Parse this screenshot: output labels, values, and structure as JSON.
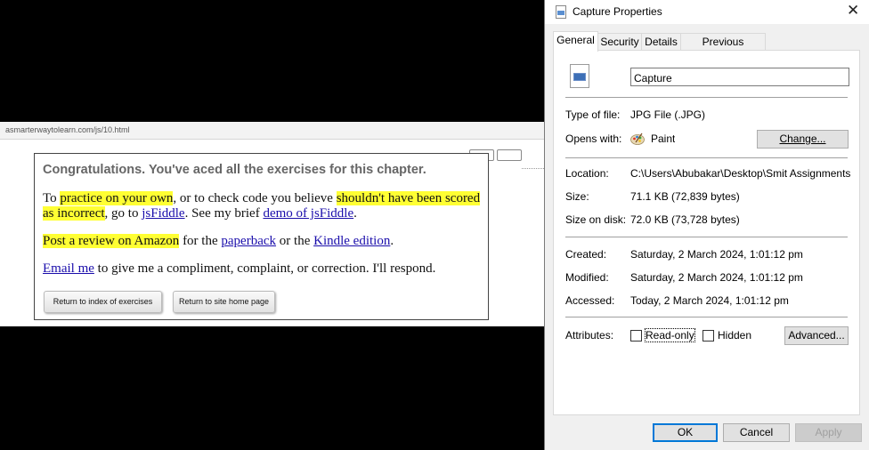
{
  "browser": {
    "url": "asmarterwaytolearn.com/js/10.html"
  },
  "card": {
    "heading": "Congratulations. You've aced all the exercises for this chapter.",
    "p1": {
      "t1": "To ",
      "h1": "practice on your own",
      "t2": ", or to check code you believe ",
      "h2": "shouldn't have been scored as incorrect",
      "t3": ", go to ",
      "l1": "jsFiddle",
      "t4": ". See my brief ",
      "l2": "demo of jsFiddle",
      "t5": "."
    },
    "p2": {
      "h1": "Post a review on Amazon",
      "t1": " for the ",
      "l1": "paperback",
      "t2": " or the ",
      "l2": "Kindle edition",
      "t3": "."
    },
    "p3": {
      "l1": "Email me",
      "t1": " to give me a compliment, complaint, or correction. I'll respond."
    },
    "buttons": {
      "index": "Return to index of exercises",
      "home": "Return to site home page"
    }
  },
  "dialog": {
    "title": "Capture Properties",
    "close": "✕",
    "tabs": [
      "General",
      "Security",
      "Details",
      "Previous Versions"
    ],
    "file_name": "Capture",
    "rows": {
      "type_label": "Type of file:",
      "type_value": "JPG File (.JPG)",
      "opens_label": "Opens with:",
      "opens_value": "Paint",
      "change_button": "Change...",
      "location_label": "Location:",
      "location_value": "C:\\Users\\Abubakar\\Desktop\\Smit Assignments\\Ass",
      "size_label": "Size:",
      "size_value": "71.1 KB (72,839 bytes)",
      "disk_label": "Size on disk:",
      "disk_value": "72.0 KB (73,728 bytes)",
      "created_label": "Created:",
      "created_value": "Saturday, 2 March 2024, 1:01:12 pm",
      "modified_label": "Modified:",
      "modified_value": "Saturday, 2 March 2024, 1:01:12 pm",
      "accessed_label": "Accessed:",
      "accessed_value": "Today, 2 March 2024, 1:01:12 pm",
      "attributes_label": "Attributes:",
      "readonly_label": "Read-only",
      "readonly_checked": false,
      "hidden_label": "Hidden",
      "hidden_checked": false,
      "advanced_button": "Advanced..."
    },
    "footer": {
      "ok": "OK",
      "cancel": "Cancel",
      "apply": "Apply"
    }
  }
}
